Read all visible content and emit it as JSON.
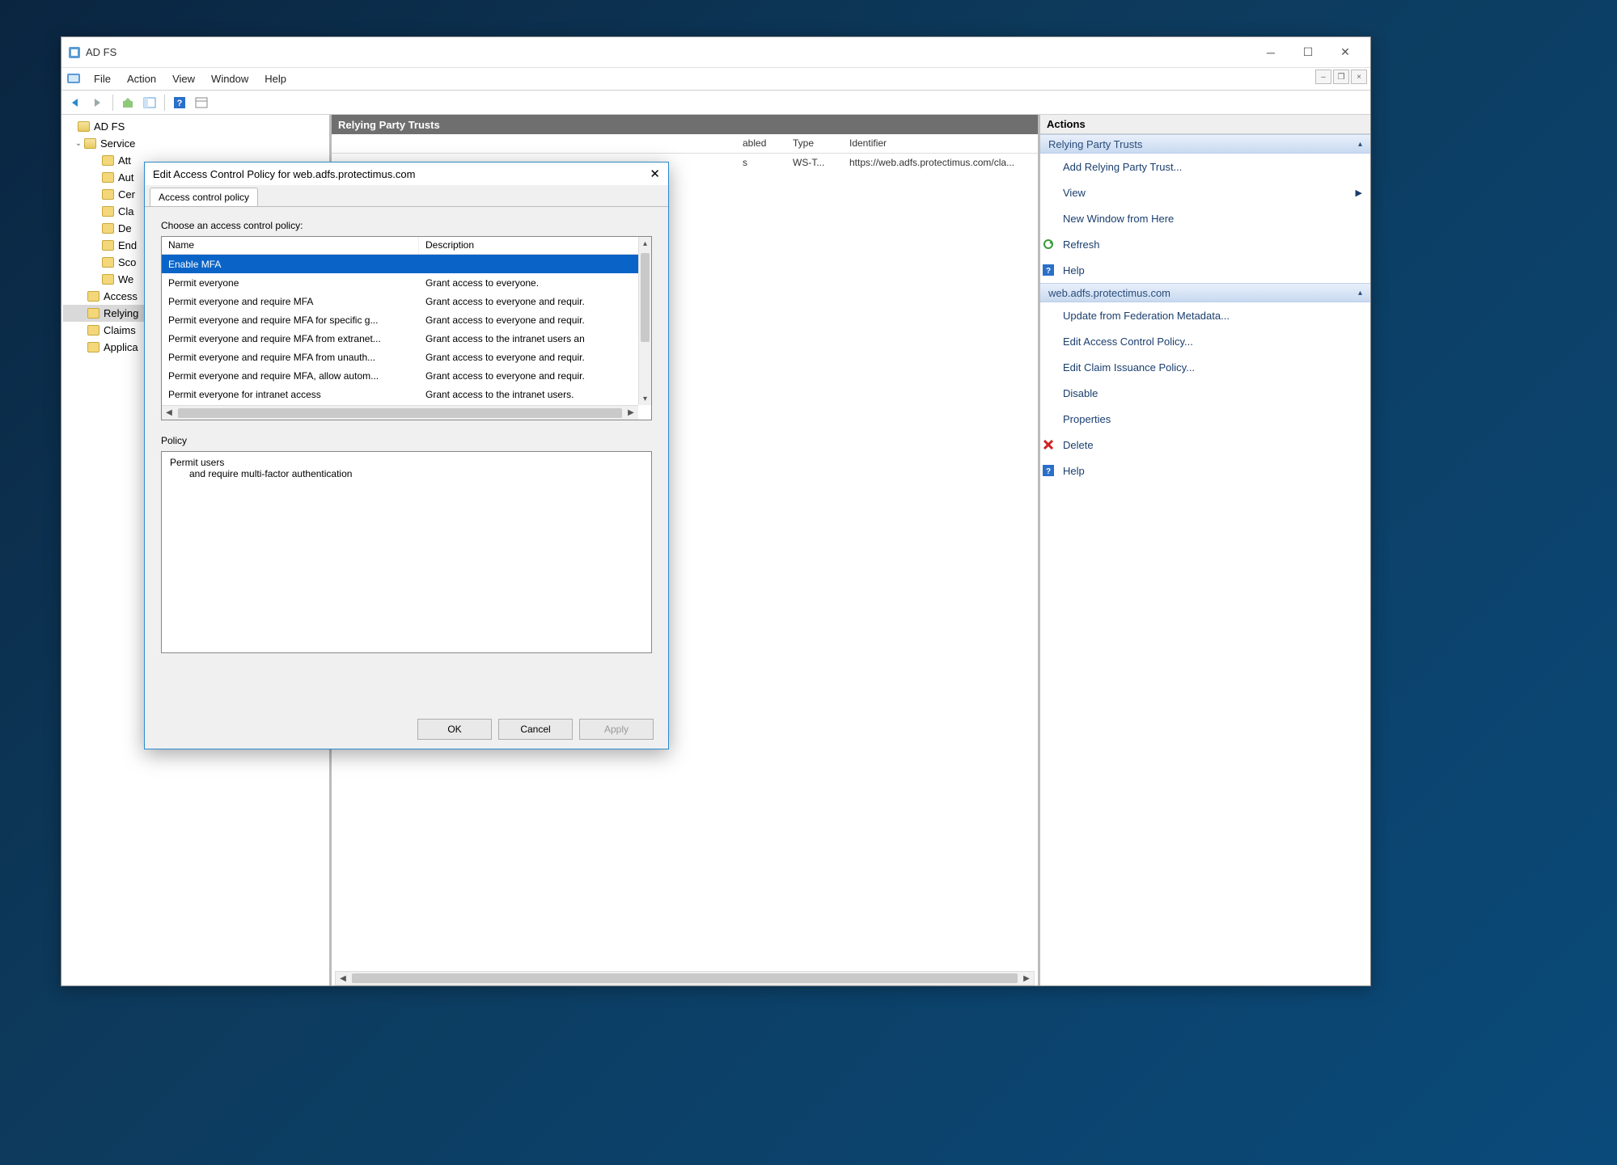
{
  "window": {
    "title": "AD FS"
  },
  "menu": {
    "file": "File",
    "action": "Action",
    "view": "View",
    "window": "Window",
    "help": "Help"
  },
  "tree": {
    "root": "AD FS",
    "service": "Service",
    "items": [
      "Att",
      "Aut",
      "Cer",
      "Cla",
      "De",
      "End",
      "Sco",
      "We"
    ],
    "access": "Access",
    "relying": "Relying",
    "claims": "Claims",
    "applica": "Applica"
  },
  "center": {
    "header": "Relying Party Trusts",
    "cols": {
      "enabled_tail": "abled",
      "type": "Type",
      "identifier": "Identifier"
    },
    "row": {
      "enabled_tail": "s",
      "type": "WS-T...",
      "identifier": "https://web.adfs.protectimus.com/cla..."
    }
  },
  "actions": {
    "title": "Actions",
    "group1": "Relying Party Trusts",
    "g1_items": {
      "add": "Add Relying Party Trust...",
      "view": "View",
      "newwin": "New Window from Here",
      "refresh": "Refresh",
      "help": "Help"
    },
    "group2": "web.adfs.protectimus.com",
    "g2_items": {
      "update": "Update from Federation Metadata...",
      "editacp": "Edit Access Control Policy...",
      "editcip": "Edit Claim Issuance Policy...",
      "disable": "Disable",
      "props": "Properties",
      "delete": "Delete",
      "help": "Help"
    }
  },
  "dialog": {
    "title": "Edit Access Control Policy for web.adfs.protectimus.com",
    "tab": "Access control policy",
    "choose": "Choose an access control policy:",
    "cols": {
      "name": "Name",
      "desc": "Description"
    },
    "policies": [
      {
        "name": "Enable MFA",
        "desc": "",
        "selected": true
      },
      {
        "name": "Permit everyone",
        "desc": "Grant access to everyone."
      },
      {
        "name": "Permit everyone and require MFA",
        "desc": "Grant access to everyone and requir."
      },
      {
        "name": "Permit everyone and require MFA for specific g...",
        "desc": "Grant access to everyone and requir."
      },
      {
        "name": "Permit everyone and require MFA from extranet...",
        "desc": "Grant access to the intranet users an"
      },
      {
        "name": "Permit everyone and require MFA from unauth...",
        "desc": "Grant access to everyone and requir."
      },
      {
        "name": "Permit everyone and require MFA, allow autom...",
        "desc": "Grant access to everyone and requir."
      },
      {
        "name": "Permit everyone for intranet access",
        "desc": "Grant access to the intranet users."
      }
    ],
    "policy_label": "Policy",
    "policy_text_1": "Permit users",
    "policy_text_2": "and require multi-factor authentication",
    "ok": "OK",
    "cancel": "Cancel",
    "apply": "Apply"
  }
}
